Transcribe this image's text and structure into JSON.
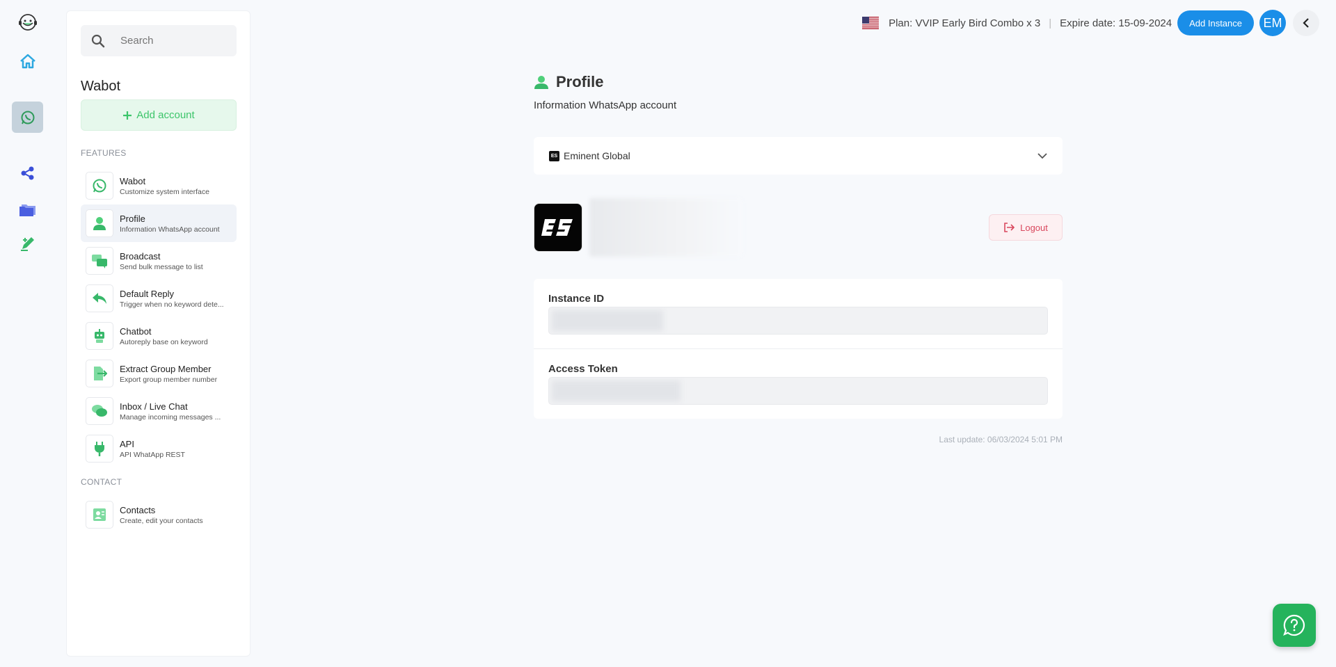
{
  "rail": {
    "items": [
      {
        "name": "support-bot-icon"
      },
      {
        "name": "home-icon"
      },
      {
        "name": "whatsapp-icon"
      },
      {
        "name": "share-icon"
      },
      {
        "name": "folder-icon"
      },
      {
        "name": "edit-icon"
      }
    ]
  },
  "sidebar": {
    "search_placeholder": "Search",
    "title": "Wabot",
    "add_account_label": "Add account",
    "features_label": "FEATURES",
    "contact_label": "CONTACT",
    "features": [
      {
        "title": "Wabot",
        "subtitle": "Customize system interface"
      },
      {
        "title": "Profile",
        "subtitle": "Information WhatsApp account"
      },
      {
        "title": "Broadcast",
        "subtitle": "Send bulk message to list"
      },
      {
        "title": "Default Reply",
        "subtitle": "Trigger when no keyword dete..."
      },
      {
        "title": "Chatbot",
        "subtitle": "Autoreply base on keyword"
      },
      {
        "title": "Extract Group Member",
        "subtitle": "Export group member number"
      },
      {
        "title": "Inbox / Live Chat",
        "subtitle": "Manage incoming messages ..."
      },
      {
        "title": "API",
        "subtitle": "API WhatApp REST"
      }
    ],
    "contacts": [
      {
        "title": "Contacts",
        "subtitle": "Create, edit your contacts"
      }
    ]
  },
  "topbar": {
    "plan": "Plan: VVIP Early Bird Combo x 3",
    "separator": "|",
    "expire": "Expire date: 15-09-2024",
    "add_instance_label": "Add Instance",
    "avatar_initials": "EM"
  },
  "main": {
    "title": "Profile",
    "subtitle": "Information WhatsApp account",
    "selected_account": "Eminent Global",
    "account_logo_text": "ES",
    "logout_label": "Logout",
    "instance_id_label": "Instance ID",
    "access_token_label": "Access Token",
    "last_update": "Last update: 06/03/2024 5:01 PM"
  },
  "colors": {
    "accent": "#1a8ee8",
    "green": "#3cc56a",
    "danger": "#d9475d"
  }
}
